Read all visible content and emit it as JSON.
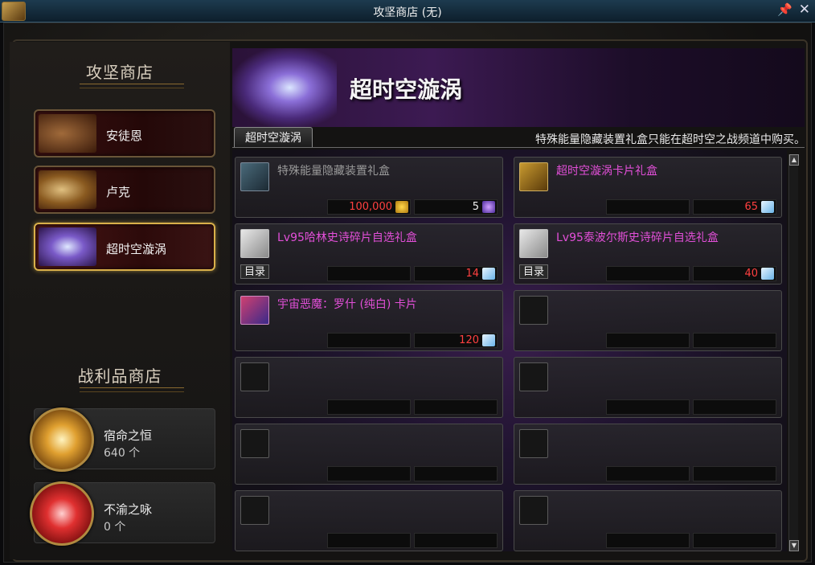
{
  "window": {
    "title": "攻坚商店 (无)"
  },
  "sidebar": {
    "shop_title": "攻坚商店",
    "shops": [
      {
        "label": "安徒恩"
      },
      {
        "label": "卢克"
      },
      {
        "label": "超时空漩涡"
      }
    ],
    "loot_title": "战利品商店",
    "currencies": [
      {
        "name": "宿命之恒",
        "count": "640 个"
      },
      {
        "name": "不渝之咏",
        "count": "0 个"
      }
    ]
  },
  "main": {
    "banner_title": "超时空漩涡",
    "tab_label": "超时空漩涡",
    "notice": "特殊能量隐藏装置礼盒只能在超时空之战频道中购买。",
    "items": [
      {
        "name": "特殊能量隐藏装置礼盒",
        "price1": "100,000",
        "price2": "5"
      },
      {
        "name": "超时空漩涡卡片礼盒",
        "price2": "65"
      },
      {
        "name": "Lv95哈林史诗碎片自选礼盒",
        "tag": "目录",
        "price2": "14"
      },
      {
        "name": "Lv95泰波尔斯史诗碎片自选礼盒",
        "tag": "目录",
        "price2": "40"
      },
      {
        "name": "宇宙恶魔：罗什 (纯白) 卡片",
        "price2": "120"
      }
    ]
  },
  "colors": {
    "accent_gold": "#d9b04a",
    "item_name_pink": "#e24fd8",
    "item_name_gray": "#9a9a9a",
    "price_red": "#ff4040"
  }
}
